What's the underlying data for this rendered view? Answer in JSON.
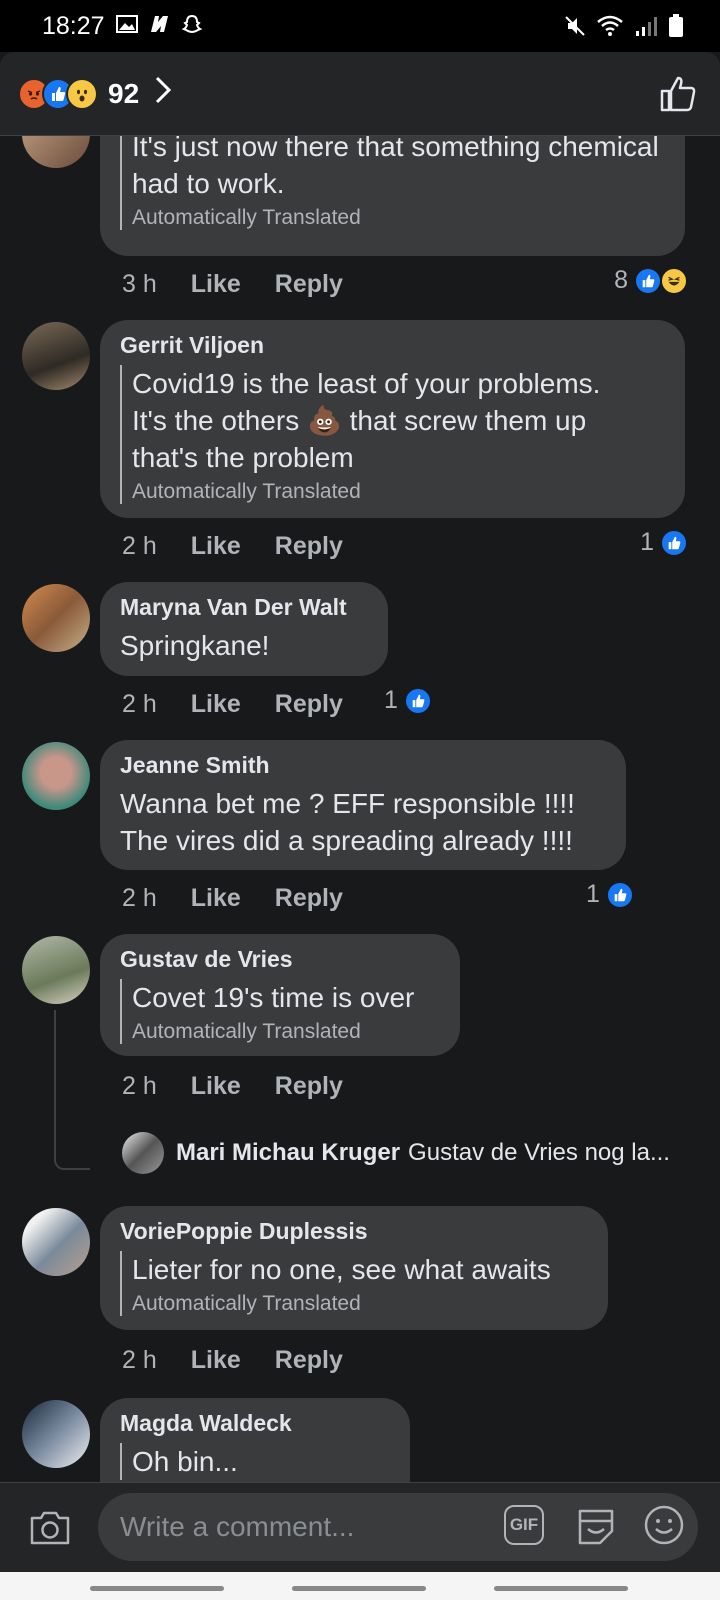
{
  "status_bar": {
    "time": "18:27"
  },
  "header": {
    "reaction_count": "92",
    "reaction_icons": [
      "angry",
      "like",
      "wow"
    ]
  },
  "comments": [
    {
      "author": "",
      "text": "It's just now there that something chemical had to work.",
      "translated": "Automatically Translated",
      "time": "3 h",
      "like": "Like",
      "reply": "Reply",
      "reactions_count": "8"
    },
    {
      "author": "Gerrit Viljoen",
      "text_line1": "Covid19 is the least of your problems.",
      "text_line2a": "It's the others ",
      "text_emoji": "💩",
      "text_line2b": " that screw them up",
      "text_line3": "that's the problem",
      "translated": "Automatically Translated",
      "time": "2 h",
      "like": "Like",
      "reply": "Reply",
      "reactions_count": "1"
    },
    {
      "author": "Maryna Van Der Walt",
      "text": "Springkane!",
      "time": "2 h",
      "like": "Like",
      "reply": "Reply",
      "reactions_count": "1"
    },
    {
      "author": "Jeanne Smith",
      "text_line1": "Wanna bet me ? EFF responsible !!!!",
      "text_line2": "The vires did a spreading already !!!!",
      "time": "2 h",
      "like": "Like",
      "reply": "Reply",
      "reactions_count": "1"
    },
    {
      "author": "Gustav de Vries",
      "text": "Covet 19's time is over",
      "translated": "Automatically Translated",
      "time": "2 h",
      "like": "Like",
      "reply": "Reply",
      "reply_preview": {
        "author": "Mari Michau Kruger",
        "text": "Gustav de Vries nog la..."
      }
    },
    {
      "author": "VoriePoppie Duplessis",
      "text": "Lieter for no one, see what awaits",
      "translated": "Automatically Translated",
      "time": "2 h",
      "like": "Like",
      "reply": "Reply"
    },
    {
      "author": "Magda Waldeck",
      "text": "Oh bin..."
    }
  ],
  "composer": {
    "placeholder": "Write a comment...",
    "gif_label": "GIF"
  },
  "colors": {
    "background": "#18191a",
    "bubble": "#3a3b3c",
    "accent": "#1877f2"
  }
}
